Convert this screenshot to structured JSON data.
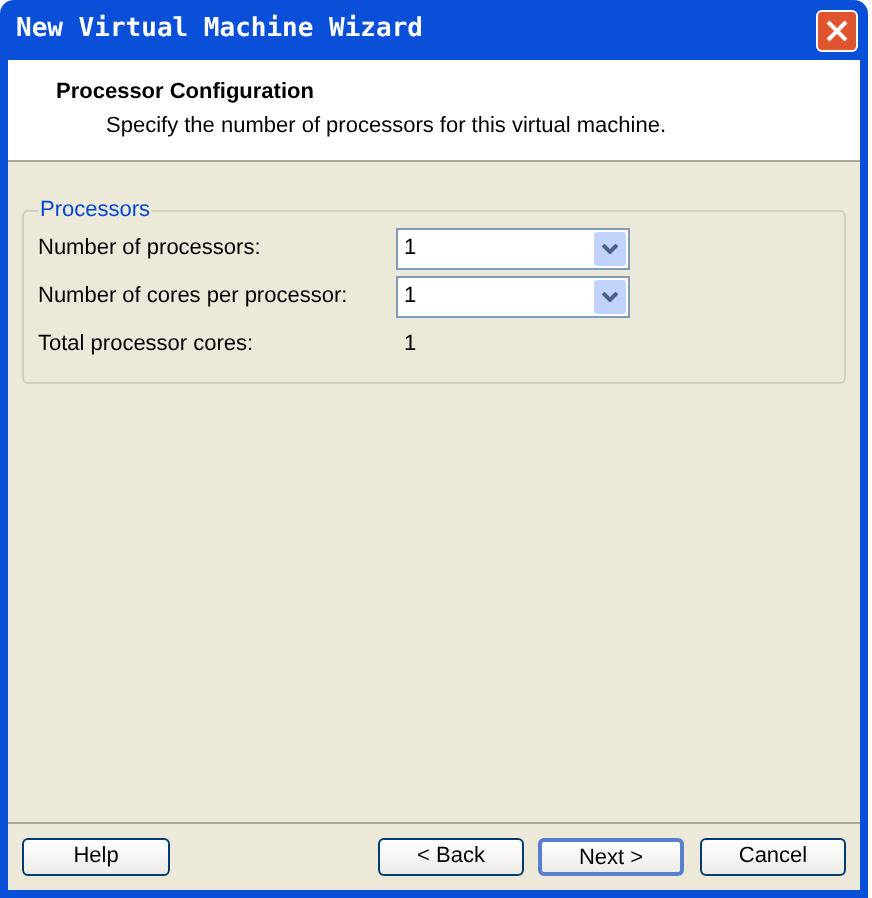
{
  "window": {
    "title": "New Virtual Machine Wizard"
  },
  "header": {
    "title": "Processor Configuration",
    "subtitle": "Specify the number of processors for this virtual machine."
  },
  "group": {
    "title": "Processors",
    "rows": [
      {
        "kind": "dropdown",
        "label": "Number of processors:",
        "value": "1"
      },
      {
        "kind": "dropdown",
        "label": "Number of cores per processor:",
        "value": "1"
      },
      {
        "kind": "readout",
        "label": "Total processor cores:",
        "value": "1"
      }
    ]
  },
  "buttons": [
    {
      "label": "Help",
      "default": false
    },
    {
      "label": "< Back",
      "default": false
    },
    {
      "label": "Next >",
      "default": true
    },
    {
      "label": "Cancel",
      "default": false
    }
  ]
}
